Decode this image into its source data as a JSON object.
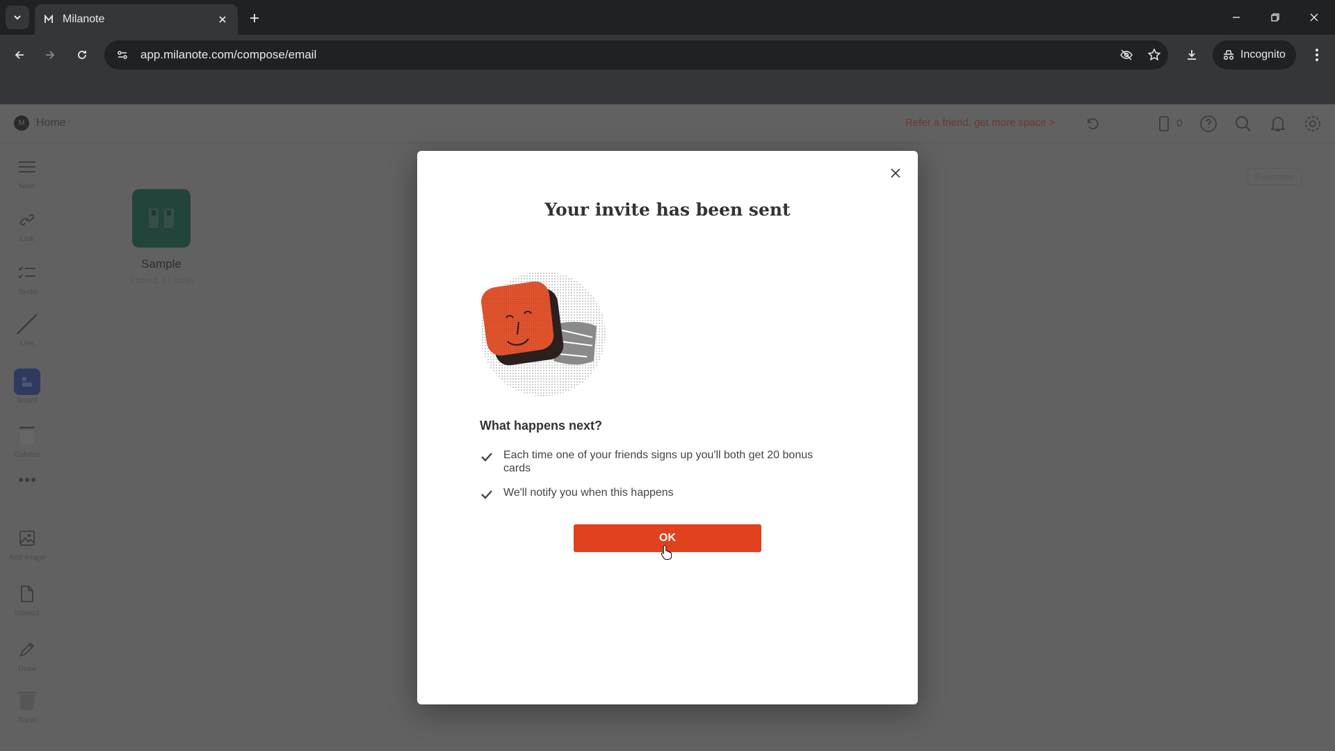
{
  "browser": {
    "tab_title": "Milanote",
    "url": "app.milanote.com/compose/email",
    "incognito_label": "Incognito"
  },
  "app": {
    "home_label": "Home",
    "refer_link": "Refer a friend, get more space >",
    "card_count": "0",
    "unsorted_label": "0 unsorted",
    "sidebar": [
      {
        "label": "Note",
        "icon": "note-icon"
      },
      {
        "label": "Link",
        "icon": "link-icon"
      },
      {
        "label": "To-do",
        "icon": "todo-icon"
      },
      {
        "label": "Line",
        "icon": "line-icon"
      },
      {
        "label": "Board",
        "icon": "board-icon"
      },
      {
        "label": "Column",
        "icon": "column-icon"
      },
      {
        "label": "",
        "icon": "more-icon"
      },
      {
        "label": "Add image",
        "icon": "image-icon"
      },
      {
        "label": "Upload",
        "icon": "upload-icon"
      },
      {
        "label": "Draw",
        "icon": "draw-icon"
      },
      {
        "label": "Trash",
        "icon": "trash-icon"
      }
    ],
    "board": {
      "name": "Sample",
      "meta": "1 board, 17 cards"
    }
  },
  "modal": {
    "title": "Your invite has been sent",
    "next_title": "What happens next?",
    "items": [
      "Each time one of your friends signs up you'll both get 20 bonus cards",
      "We'll notify you when this happens"
    ],
    "ok_label": "OK"
  },
  "colors": {
    "accent": "#e0411f",
    "overlay": "#616161",
    "chrome_dark": "#202124"
  }
}
